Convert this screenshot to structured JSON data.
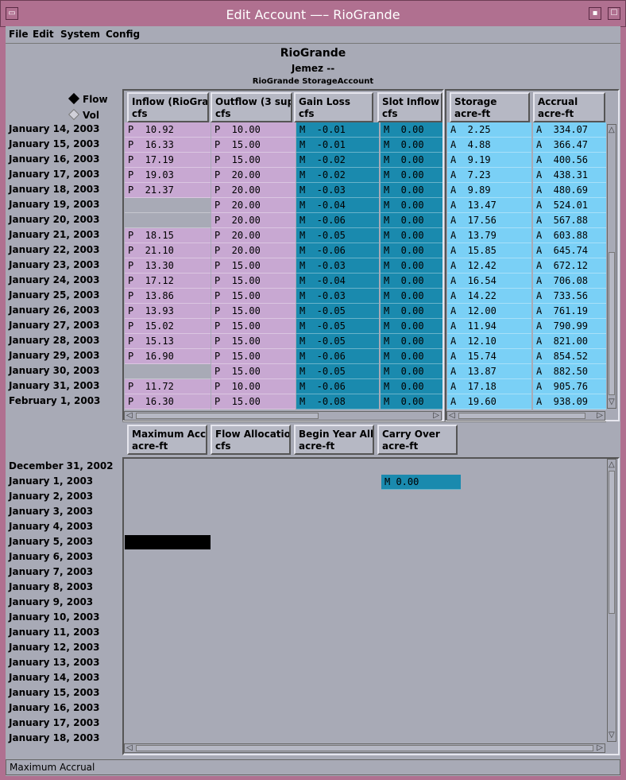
{
  "window": {
    "title": "Edit Account —– RioGrande"
  },
  "menubar": {
    "items": [
      "File",
      "Edit",
      "System",
      "Config"
    ]
  },
  "header": {
    "line1": "RioGrande",
    "line2": "Jemez --",
    "line3": "RioGrande StorageAccount"
  },
  "mode": {
    "flow": "Flow",
    "vol": "Vol",
    "selected": "Flow"
  },
  "upper_columns": [
    {
      "name": "Inflow (RioGrar",
      "unit": "cfs"
    },
    {
      "name": "Outflow (3 sup",
      "unit": "cfs"
    },
    {
      "name": "Gain Loss",
      "unit": "cfs"
    },
    {
      "name": "Slot Inflow",
      "unit": "cfs"
    },
    {
      "name": "Storage",
      "unit": "acre-ft"
    },
    {
      "name": "Accrual",
      "unit": "acre-ft"
    }
  ],
  "upper_rows": [
    {
      "date": "January 14, 2003",
      "inflow": "P  10.92",
      "outflow": "P  10.00",
      "gain": "M  -0.01",
      "slot": "M  0.00",
      "storage": "A  2.25",
      "accrual": "A  334.07"
    },
    {
      "date": "January 15, 2003",
      "inflow": "P  16.33",
      "outflow": "P  15.00",
      "gain": "M  -0.01",
      "slot": "M  0.00",
      "storage": "A  4.88",
      "accrual": "A  366.47"
    },
    {
      "date": "January 16, 2003",
      "inflow": "P  17.19",
      "outflow": "P  15.00",
      "gain": "M  -0.02",
      "slot": "M  0.00",
      "storage": "A  9.19",
      "accrual": "A  400.56"
    },
    {
      "date": "January 17, 2003",
      "inflow": "P  19.03",
      "outflow": "P  20.00",
      "gain": "M  -0.02",
      "slot": "M  0.00",
      "storage": "A  7.23",
      "accrual": "A  438.31"
    },
    {
      "date": "January 18, 2003",
      "inflow": "P  21.37",
      "outflow": "P  20.00",
      "gain": "M  -0.03",
      "slot": "M  0.00",
      "storage": "A  9.89",
      "accrual": "A  480.69"
    },
    {
      "date": "January 19, 2003",
      "inflow": "",
      "outflow": "P  20.00",
      "gain": "M  -0.04",
      "slot": "M  0.00",
      "storage": "A  13.47",
      "accrual": "A  524.01"
    },
    {
      "date": "January 20, 2003",
      "inflow": "",
      "outflow": "P  20.00",
      "gain": "M  -0.06",
      "slot": "M  0.00",
      "storage": "A  17.56",
      "accrual": "A  567.88"
    },
    {
      "date": "January 21, 2003",
      "inflow": "P  18.15",
      "outflow": "P  20.00",
      "gain": "M  -0.05",
      "slot": "M  0.00",
      "storage": "A  13.79",
      "accrual": "A  603.88"
    },
    {
      "date": "January 22, 2003",
      "inflow": "P  21.10",
      "outflow": "P  20.00",
      "gain": "M  -0.06",
      "slot": "M  0.00",
      "storage": "A  15.85",
      "accrual": "A  645.74"
    },
    {
      "date": "January 23, 2003",
      "inflow": "P  13.30",
      "outflow": "P  15.00",
      "gain": "M  -0.03",
      "slot": "M  0.00",
      "storage": "A  12.42",
      "accrual": "A  672.12"
    },
    {
      "date": "January 24, 2003",
      "inflow": "P  17.12",
      "outflow": "P  15.00",
      "gain": "M  -0.04",
      "slot": "M  0.00",
      "storage": "A  16.54",
      "accrual": "A  706.08"
    },
    {
      "date": "January 25, 2003",
      "inflow": "P  13.86",
      "outflow": "P  15.00",
      "gain": "M  -0.03",
      "slot": "M  0.00",
      "storage": "A  14.22",
      "accrual": "A  733.56"
    },
    {
      "date": "January 26, 2003",
      "inflow": "P  13.93",
      "outflow": "P  15.00",
      "gain": "M  -0.05",
      "slot": "M  0.00",
      "storage": "A  12.00",
      "accrual": "A  761.19"
    },
    {
      "date": "January 27, 2003",
      "inflow": "P  15.02",
      "outflow": "P  15.00",
      "gain": "M  -0.05",
      "slot": "M  0.00",
      "storage": "A  11.94",
      "accrual": "A  790.99"
    },
    {
      "date": "January 28, 2003",
      "inflow": "P  15.13",
      "outflow": "P  15.00",
      "gain": "M  -0.05",
      "slot": "M  0.00",
      "storage": "A  12.10",
      "accrual": "A  821.00"
    },
    {
      "date": "January 29, 2003",
      "inflow": "P  16.90",
      "outflow": "P  15.00",
      "gain": "M  -0.06",
      "slot": "M  0.00",
      "storage": "A  15.74",
      "accrual": "A  854.52"
    },
    {
      "date": "January 30, 2003",
      "inflow": "",
      "outflow": "P  15.00",
      "gain": "M  -0.05",
      "slot": "M  0.00",
      "storage": "A  13.87",
      "accrual": "A  882.50"
    },
    {
      "date": "January 31, 2003",
      "inflow": "P  11.72",
      "outflow": "P  10.00",
      "gain": "M  -0.06",
      "slot": "M  0.00",
      "storage": "A  17.18",
      "accrual": "A  905.76"
    },
    {
      "date": "February 1, 2003",
      "inflow": "P  16.30",
      "outflow": "P  15.00",
      "gain": "M  -0.08",
      "slot": "M  0.00",
      "storage": "A  19.60",
      "accrual": "A  938.09"
    }
  ],
  "lower_columns": [
    {
      "name": "Maximum Accru",
      "unit": "acre-ft"
    },
    {
      "name": "Flow Allocation",
      "unit": "cfs"
    },
    {
      "name": "Begin Year Allo",
      "unit": "acre-ft"
    },
    {
      "name": "Carry Over",
      "unit": "acre-ft"
    }
  ],
  "lower_dates": [
    "December 31, 2002",
    "January 1, 2003",
    "January 2, 2003",
    "January 3, 2003",
    "January 4, 2003",
    "January 5, 2003",
    "January 6, 2003",
    "January 7, 2003",
    "January 8, 2003",
    "January 9, 2003",
    "January 10, 2003",
    "January 11, 2003",
    "January 12, 2003",
    "January 13, 2003",
    "January 14, 2003",
    "January 15, 2003",
    "January 16, 2003",
    "January 17, 2003",
    "January 18, 2003"
  ],
  "lower_cells": {
    "carry_over_jan1": "M 0.00"
  },
  "status": {
    "text": "Maximum Accrual"
  }
}
